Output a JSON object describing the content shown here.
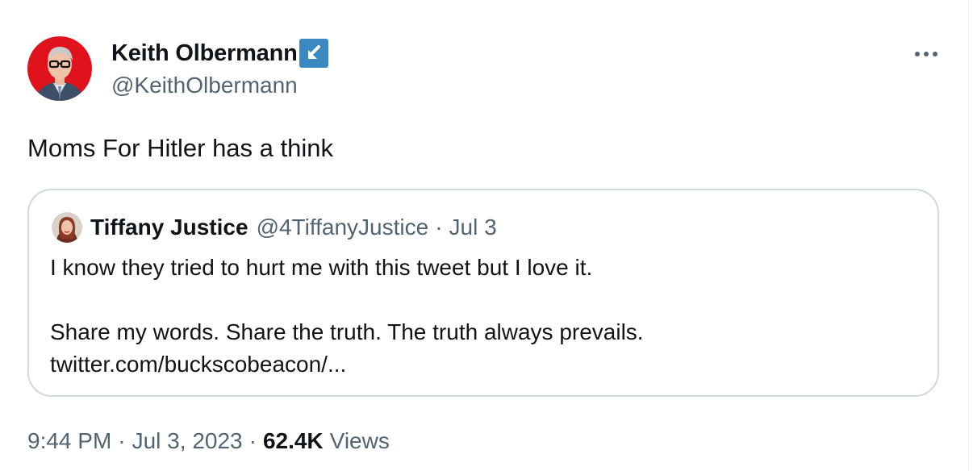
{
  "tweet": {
    "author": {
      "name": "Keith Olbermann",
      "handle": "@KeithOlbermann",
      "verified_badge_icon": "arrow-down-left-icon",
      "badge_color": "#3b88c3",
      "avatar_icon": "avatar-photo"
    },
    "text": "Moms For Hitler has a think",
    "quote": {
      "author_name": "Tiffany Justice",
      "author_handle": "@4TiffanyJustice",
      "separator": "·",
      "date": "Jul 3",
      "line1": "I know they tried to hurt me with this tweet but I love it.",
      "line2": "Share my words. Share the truth. The truth always prevails.",
      "link": "twitter.com/buckscobeacon/..."
    },
    "meta": {
      "time": "9:44 PM",
      "separator": "·",
      "date": "Jul 3, 2023",
      "views_count": "62.4K",
      "views_label": "Views"
    }
  },
  "colors": {
    "text_primary": "#0f1419",
    "text_secondary": "#536471",
    "border": "#cfd9de",
    "avatar_bg": "#e0121b"
  }
}
